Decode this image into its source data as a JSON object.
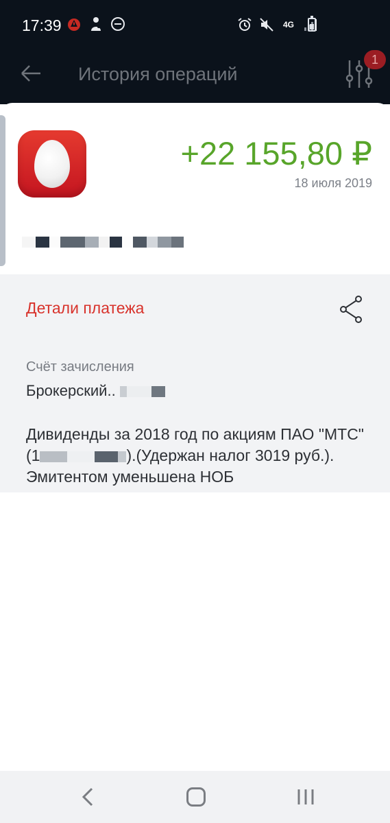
{
  "status_bar": {
    "time": "17:39",
    "network_label": "4G",
    "icons": [
      "warning-badge-icon",
      "person-icon",
      "do-not-disturb-icon",
      "alarm-icon",
      "muted-icon",
      "network-4g-icon",
      "signal-icon",
      "battery-icon"
    ]
  },
  "header": {
    "title": "История операций",
    "back_icon": "back-arrow-icon",
    "filter_icon": "filter-sliders-icon",
    "filter_badge": "1"
  },
  "operation": {
    "logo": "opera-logo-icon",
    "amount": "+22 155,80 ₽",
    "date": "18 июля 2019",
    "counterparty_masked": true
  },
  "details": {
    "title": "Детали платежа",
    "share_icon": "share-icon",
    "account_label": "Счёт зачисления",
    "account_value": "Брокерский.. ",
    "description": "Дивиденды за 2018 год по акциям ПАО \"МТС\" (1",
    "description_tail": ").(Удержан налог 3019 руб.). Эмитентом уменьшена НОБ"
  },
  "colors": {
    "accent_red": "#d8322b",
    "amount_green": "#58a52a",
    "status_bar_bg": "#0b121b"
  },
  "navbar": {
    "icons": [
      "nav-back-icon",
      "nav-home-icon",
      "nav-recents-icon"
    ]
  }
}
